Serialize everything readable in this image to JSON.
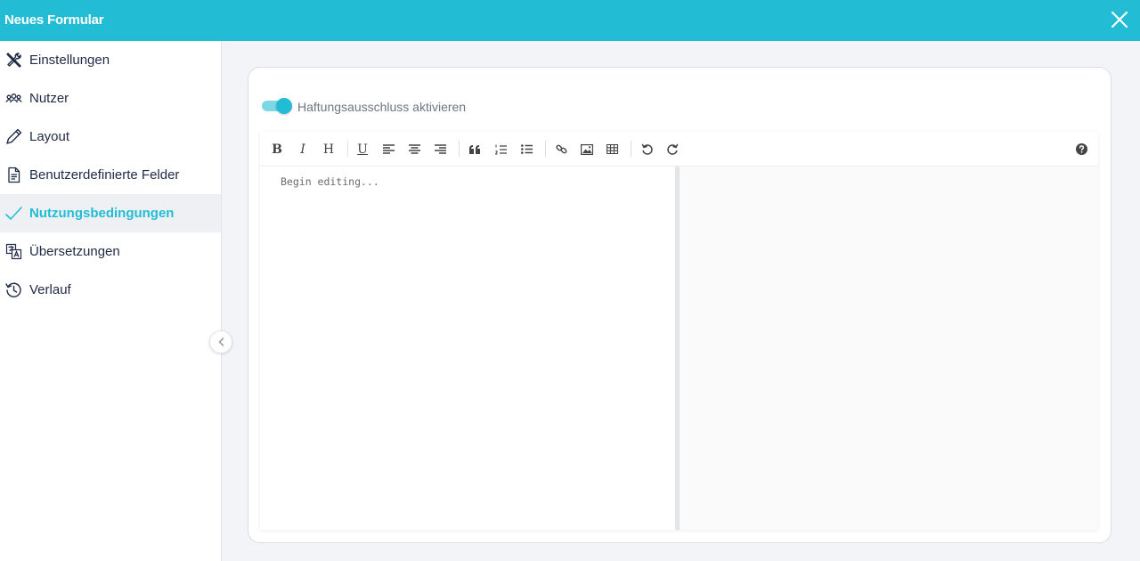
{
  "header": {
    "title": "Neues Formular"
  },
  "sidebar": {
    "items": [
      {
        "label": "Einstellungen",
        "icon": "tools-icon",
        "active": false
      },
      {
        "label": "Nutzer",
        "icon": "users-icon",
        "active": false
      },
      {
        "label": "Layout",
        "icon": "pen-icon",
        "active": false
      },
      {
        "label": "Benutzerdefinierte Felder",
        "icon": "document-icon",
        "active": false
      },
      {
        "label": "Nutzungsbedingungen",
        "icon": "checkmark-icon",
        "active": true
      },
      {
        "label": "Übersetzungen",
        "icon": "translate-icon",
        "active": false
      },
      {
        "label": "Verlauf",
        "icon": "history-icon",
        "active": false
      }
    ]
  },
  "form": {
    "toggle_label": "Haftungsausschluss aktivieren",
    "toggle_on": true
  },
  "editor": {
    "placeholder": "Begin editing...",
    "toolbar": {
      "bold": "B",
      "italic": "I",
      "heading": "H",
      "underline": "U"
    }
  },
  "colors": {
    "accent": "#22bdd4",
    "text": "#1f2a44"
  }
}
